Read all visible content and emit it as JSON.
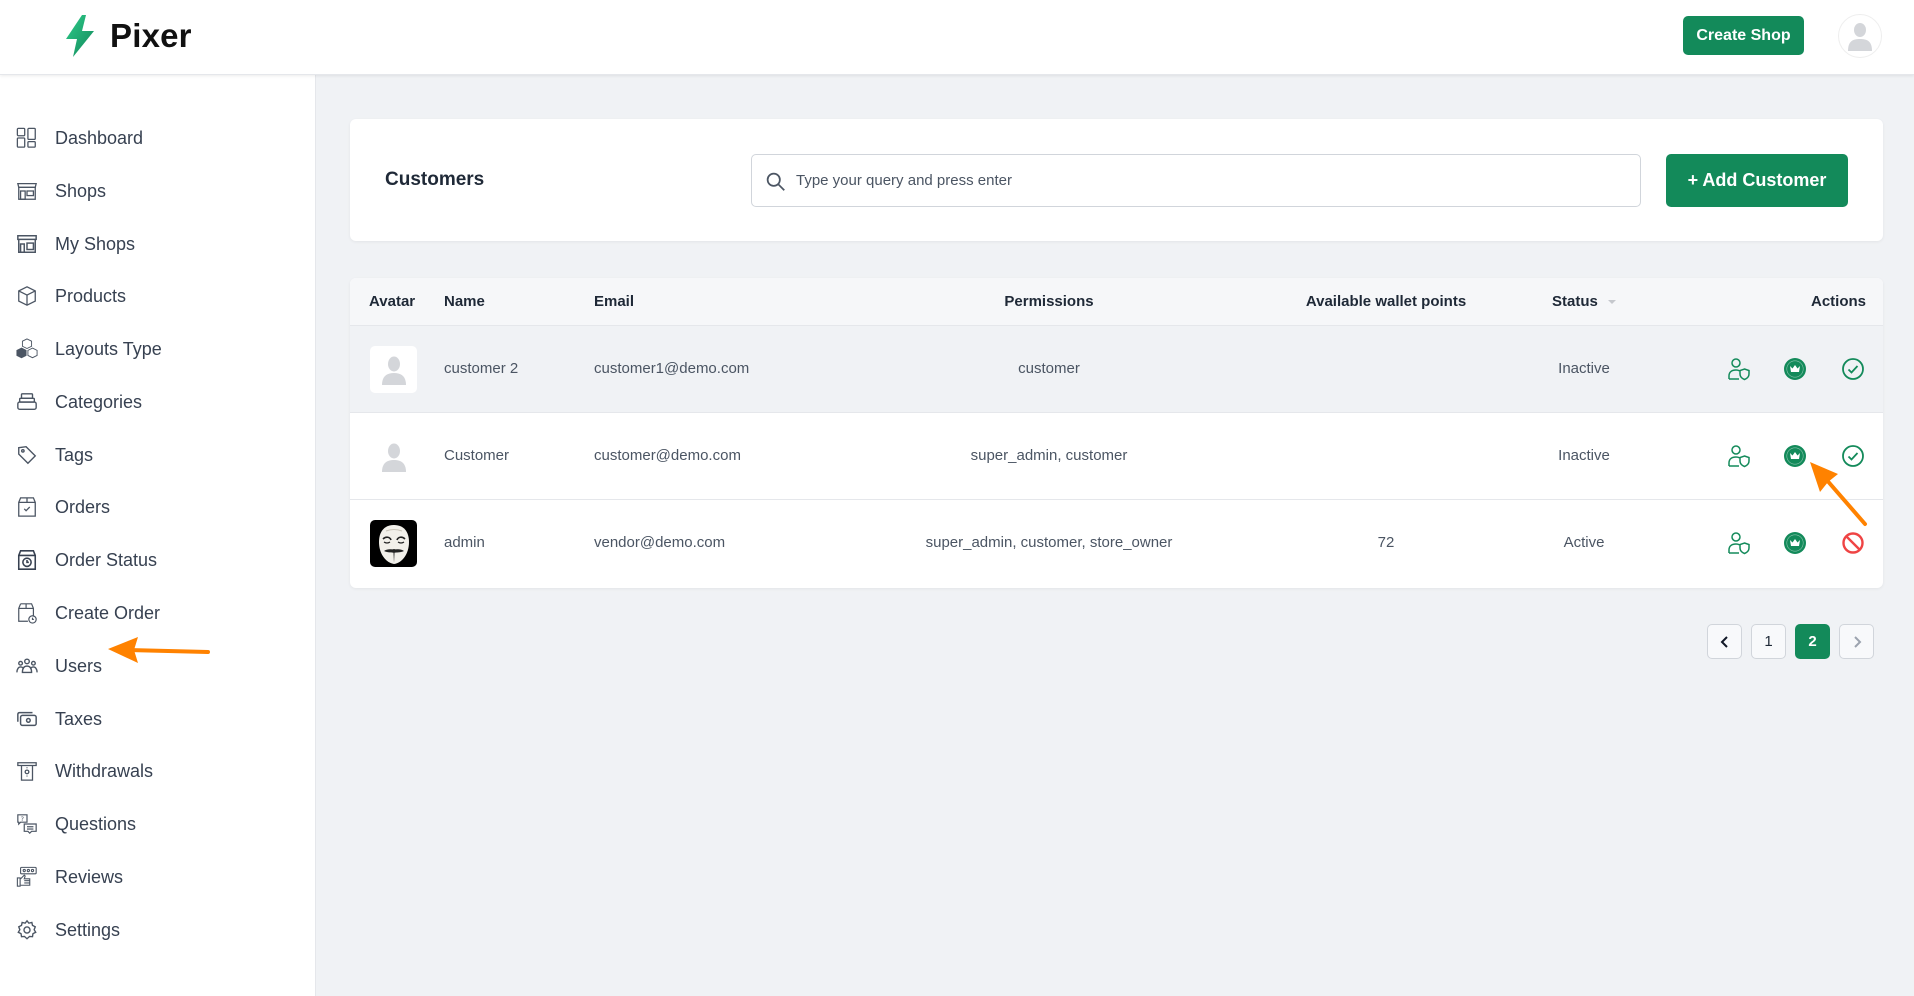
{
  "app": {
    "name": "Pixer",
    "brand_color": "#138a5a",
    "logo_icon": "lightning-bolt-icon"
  },
  "header": {
    "create_shop_label": "Create Shop",
    "avatar_icon": "user-avatar-icon"
  },
  "sidebar": {
    "items": [
      {
        "label": "Dashboard",
        "icon": "dashboard-icon"
      },
      {
        "label": "Shops",
        "icon": "shop-icon"
      },
      {
        "label": "My Shops",
        "icon": "my-shop-icon"
      },
      {
        "label": "Products",
        "icon": "cube-icon"
      },
      {
        "label": "Layouts Type",
        "icon": "cubes-icon"
      },
      {
        "label": "Categories",
        "icon": "stack-icon"
      },
      {
        "label": "Tags",
        "icon": "tag-icon"
      },
      {
        "label": "Orders",
        "icon": "order-box-icon"
      },
      {
        "label": "Order Status",
        "icon": "order-clock-icon"
      },
      {
        "label": "Create Order",
        "icon": "create-order-icon"
      },
      {
        "label": "Users",
        "icon": "users-icon"
      },
      {
        "label": "Taxes",
        "icon": "cash-icon"
      },
      {
        "label": "Withdrawals",
        "icon": "atm-icon"
      },
      {
        "label": "Questions",
        "icon": "question-chat-icon"
      },
      {
        "label": "Reviews",
        "icon": "review-icon"
      },
      {
        "label": "Settings",
        "icon": "gear-icon"
      }
    ]
  },
  "customers": {
    "title": "Customers",
    "search_placeholder": "Type your query and press enter",
    "search_value": "",
    "add_button_label": "+ Add Customer"
  },
  "table": {
    "columns": [
      "Avatar",
      "Name",
      "Email",
      "Permissions",
      "Available wallet points",
      "Status",
      "Actions"
    ],
    "rows": [
      {
        "avatar": "placeholder",
        "name": "customer 2",
        "email": "customer1@demo.com",
        "permissions": "customer",
        "wallet_points": "",
        "status": "Inactive",
        "actions": [
          "manage-permissions",
          "make-admin",
          "activate"
        ]
      },
      {
        "avatar": "placeholder",
        "name": "Customer",
        "email": "customer@demo.com",
        "permissions": "super_admin, customer",
        "wallet_points": "",
        "status": "Inactive",
        "actions": [
          "manage-permissions",
          "make-admin",
          "activate"
        ]
      },
      {
        "avatar": "mask",
        "name": "admin",
        "email": "vendor@demo.com",
        "permissions": "super_admin, customer, store_owner",
        "wallet_points": "72",
        "status": "Active",
        "actions": [
          "manage-permissions",
          "make-admin",
          "ban"
        ]
      }
    ]
  },
  "pagination": {
    "pages": [
      "1",
      "2"
    ],
    "current_page": "2"
  },
  "colors": {
    "primary": "#138a5a",
    "danger": "#ef4444",
    "annotation_arrow": "#ff8200"
  }
}
